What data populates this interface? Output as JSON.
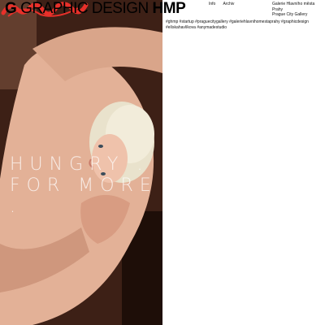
{
  "header": {
    "title_g": "G",
    "title_main": "GRAPHIC DESIGN",
    "title_hmp": "HMP"
  },
  "nav": {
    "items": [
      "Info",
      "Archiv"
    ]
  },
  "gallery": {
    "line1": "Galerie Hlavního města Prahy",
    "line2": "Prague City Gallery"
  },
  "tags": "#ghmp #startup #praguecitygallery #galeriehlavnihomestaprahy #graphicdesign #elískahavlíkova #anymadestudio",
  "poster": {
    "logo_text": "startup",
    "headline_line1": "HUNGRY .",
    "headline_line2": "FOR  MORE ."
  },
  "colors": {
    "logo_red": "#e8302a",
    "photo_dark": "#2a140b",
    "skin": "#e7b49a"
  }
}
